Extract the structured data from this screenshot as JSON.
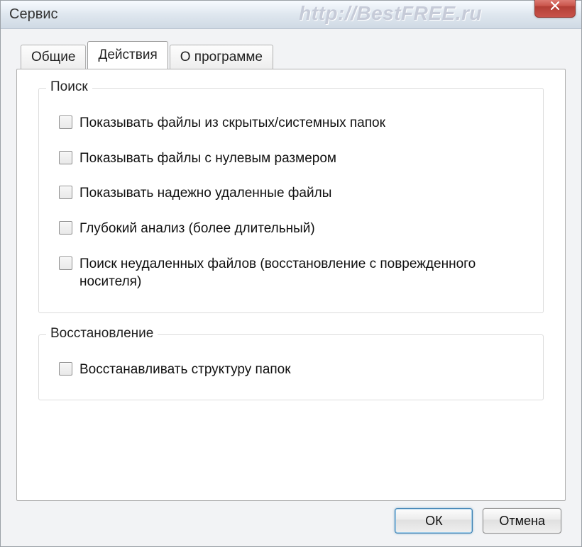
{
  "window": {
    "title": "Сервис",
    "watermark": "http://BestFREE.ru"
  },
  "tabs": {
    "general": "Общие",
    "actions": "Действия",
    "about": "О программе"
  },
  "groups": {
    "search": {
      "title": "Поиск",
      "items": [
        "Показывать файлы из скрытых/системных папок",
        "Показывать файлы с нулевым размером",
        "Показывать надежно удаленные файлы",
        "Глубокий анализ (более длительный)",
        "Поиск неудаленных файлов (восстановление с поврежденного носителя)"
      ]
    },
    "restore": {
      "title": "Восстановление",
      "items": [
        "Восстанавливать структуру папок"
      ]
    }
  },
  "buttons": {
    "ok": "ОК",
    "cancel": "Отмена"
  }
}
